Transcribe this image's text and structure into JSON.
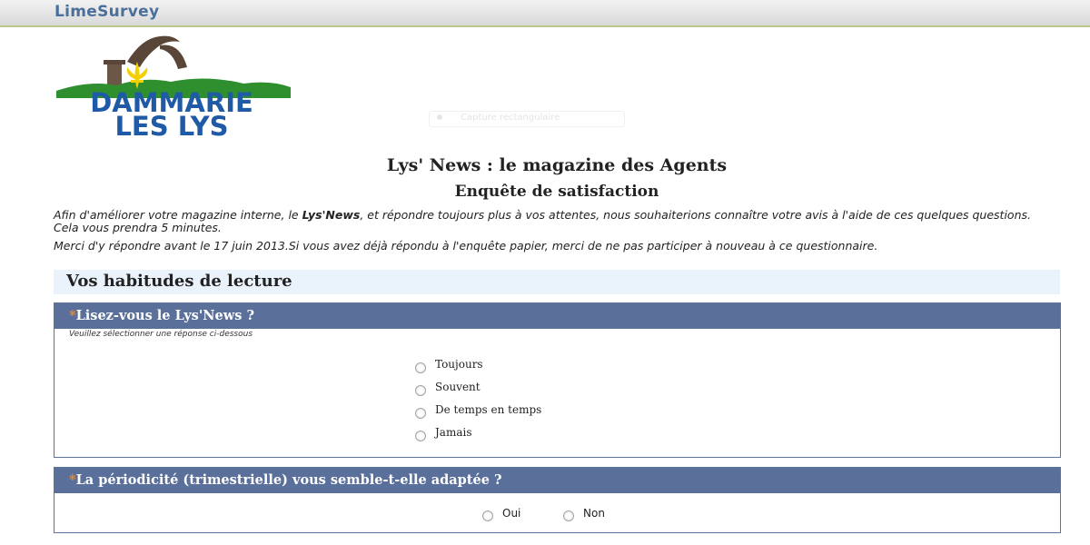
{
  "app": {
    "brand": "LimeSurvey"
  },
  "logo": {
    "line1": "DAMMARIE",
    "line2": "LES LYS",
    "colors": {
      "blue": "#1f5aa6",
      "green": "#2f8f2f",
      "yellow": "#f4d000",
      "brown": "#5a4638"
    }
  },
  "ghost": {
    "text": "Capture rectangulaire"
  },
  "survey": {
    "title": "Lys' News : le magazine des Agents",
    "subtitle": "Enquête de satisfaction",
    "intro1_pre": "Afin d'améliorer votre magazine interne, le ",
    "intro1_bold": "Lys'News",
    "intro1_post": ", et répondre toujours plus à vos attentes, nous souhaiterions connaître votre avis à l'aide de ces quelques questions. Cela vous prendra 5 minutes.",
    "intro2": "Merci d'y répondre avant le 17 juin 2013.Si vous avez déjà répondu à l'enquête papier, merci de ne pas participer à nouveau à ce questionnaire."
  },
  "group": {
    "title": "Vos habitudes de lecture"
  },
  "questions": [
    {
      "mandatory": "*",
      "text": "Lisez-vous le Lys'News ?",
      "help": "Veuillez sélectionner une réponse ci-dessous",
      "options": [
        "Toujours",
        "Souvent",
        "De temps en temps",
        "Jamais"
      ]
    },
    {
      "mandatory": "*",
      "text": "La périodicité (trimestrielle) vous semble-t-elle adaptée ?",
      "options": [
        "Oui",
        "Non"
      ]
    }
  ],
  "colors": {
    "question_header": "#5a6f9a",
    "mandatory": "#f08a2c",
    "group_bg": "#eaf3fb",
    "brand": "#4a6f9c"
  }
}
